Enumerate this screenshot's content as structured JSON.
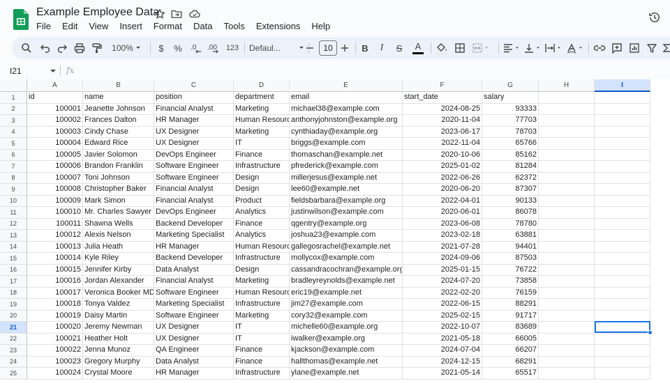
{
  "app": {
    "title": "Example Employee Data",
    "brand_color": "#0f9d58",
    "icons": [
      "star-icon",
      "move-to-folder-icon",
      "cloud-status-icon",
      "version-history-icon"
    ]
  },
  "menu": [
    "File",
    "Edit",
    "View",
    "Insert",
    "Format",
    "Data",
    "Tools",
    "Extensions",
    "Help"
  ],
  "toolbar": {
    "zoom": "100%",
    "currency": "$",
    "percent": "%",
    "decimal_decrease": ".0←",
    "decimal_increase": ".00",
    "more_formats": "123",
    "font": "Defaul...",
    "font_size": "10",
    "bold": "B",
    "italic": "I",
    "strike": "S",
    "text_color": "A"
  },
  "formula_bar": {
    "name_box": "I21",
    "fx": "fx",
    "value": ""
  },
  "columns": [
    "A",
    "B",
    "C",
    "D",
    "E",
    "F",
    "G",
    "H",
    "I"
  ],
  "selected_column": "I",
  "selected_row": 21,
  "header_row": [
    "id",
    "name",
    "position",
    "department",
    "email",
    "start_date",
    "salary"
  ],
  "rows": [
    [
      "100001",
      "Jeanette Johnson",
      "Financial Analyst",
      "Marketing",
      "michael38@example.com",
      "2024-08-25",
      "93333"
    ],
    [
      "100002",
      "Frances Dalton",
      "HR Manager",
      "Human Resourc",
      "anthonyjohnston@example.org",
      "2020-11-04",
      "77703"
    ],
    [
      "100003",
      "Cindy Chase",
      "UX Designer",
      "Marketing",
      "cynthiaday@example.org",
      "2023-06-17",
      "78703"
    ],
    [
      "100004",
      "Edward Rice",
      "UX Designer",
      "IT",
      "briggs@example.com",
      "2022-11-04",
      "65766"
    ],
    [
      "100005",
      "Javier Solomon",
      "DevOps Engineer",
      "Finance",
      "thomaschan@example.net",
      "2020-10-06",
      "85162"
    ],
    [
      "100006",
      "Brandon Franklin",
      "Software Engineer",
      "Infrastructure",
      "pfrederick@example.com",
      "2025-01-02",
      "81284"
    ],
    [
      "100007",
      "Toni Johnson",
      "Software Engineer",
      "Design",
      "millerjesus@example.net",
      "2022-06-26",
      "62372"
    ],
    [
      "100008",
      "Christopher Baker",
      "Financial Analyst",
      "Design",
      "lee60@example.net",
      "2020-06-20",
      "87307"
    ],
    [
      "100009",
      "Mark Simon",
      "Financial Analyst",
      "Product",
      "fieldsbarbara@example.org",
      "2022-04-01",
      "90133"
    ],
    [
      "100010",
      "Mr. Charles Sawyer",
      "DevOps Engineer",
      "Analytics",
      "justinwilson@example.com",
      "2020-06-01",
      "86078"
    ],
    [
      "100011",
      "Shawna Wells",
      "Backend Developer",
      "Finance",
      "qgentry@example.org",
      "2023-06-08",
      "78780"
    ],
    [
      "100012",
      "Alexis Nelson",
      "Marketing Specialist",
      "Analytics",
      "joshua23@example.com",
      "2023-02-18",
      "63881"
    ],
    [
      "100013",
      "Julia Heath",
      "HR Manager",
      "Human Resourc",
      "gallegosrachel@example.net",
      "2021-07-28",
      "94401"
    ],
    [
      "100014",
      "Kyle Riley",
      "Backend Developer",
      "Infrastructure",
      "mollycox@example.com",
      "2024-09-06",
      "87503"
    ],
    [
      "100015",
      "Jennifer Kirby",
      "Data Analyst",
      "Design",
      "cassandracochran@example.org",
      "2025-01-15",
      "76722"
    ],
    [
      "100016",
      "Jordan Alexander",
      "Financial Analyst",
      "Marketing",
      "bradleyreynolds@example.net",
      "2024-07-20",
      "73858"
    ],
    [
      "100017",
      "Veronica Booker MD",
      "Software Engineer",
      "Human Resourc",
      "eric19@example.net",
      "2022-02-20",
      "76159"
    ],
    [
      "100018",
      "Tonya Valdez",
      "Marketing Specialist",
      "Infrastructure",
      "jim27@example.com",
      "2022-06-15",
      "88291"
    ],
    [
      "100019",
      "Daisy Martin",
      "Software Engineer",
      "Marketing",
      "cory32@example.com",
      "2025-02-15",
      "91717"
    ],
    [
      "100020",
      "Jeremy Newman",
      "UX Designer",
      "IT",
      "michelle60@example.org",
      "2022-10-07",
      "83689"
    ],
    [
      "100021",
      "Heather Holt",
      "UX Designer",
      "IT",
      "iwalker@example.org",
      "2021-05-18",
      "66005"
    ],
    [
      "100022",
      "Jenna Munoz",
      "QA Engineer",
      "Finance",
      "kjackson@example.com",
      "2024-07-04",
      "66207"
    ],
    [
      "100023",
      "Gregory Murphy",
      "Data Analyst",
      "Finance",
      "hallthomas@example.net",
      "2024-12-15",
      "68291"
    ],
    [
      "100024",
      "Crystal Moore",
      "HR Manager",
      "Infrastructure",
      "ylane@example.net",
      "2021-05-14",
      "65517"
    ]
  ]
}
